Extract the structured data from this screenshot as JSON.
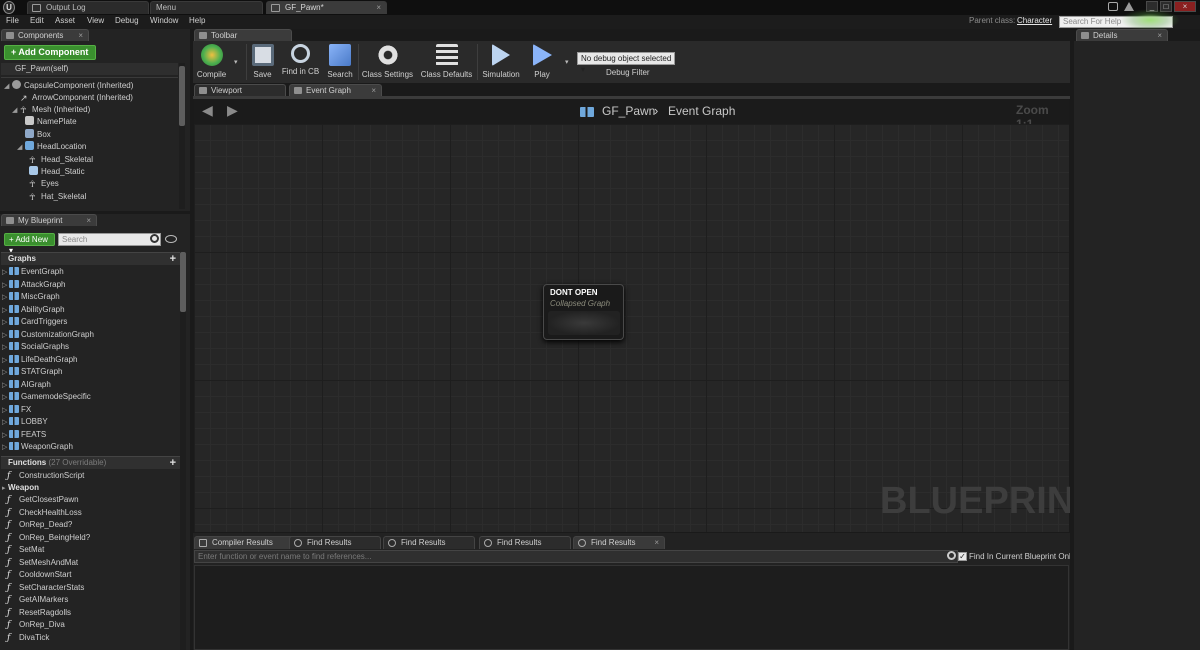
{
  "titlebar": {
    "logo": "U",
    "tabs": [
      {
        "label": "Output Log",
        "active": false
      },
      {
        "label": "Menu",
        "active": false
      },
      {
        "label": "GF_Pawn*",
        "active": true
      }
    ],
    "window_buttons": [
      "_",
      "□",
      "×"
    ]
  },
  "menubar": {
    "items": [
      "File",
      "Edit",
      "Asset",
      "View",
      "Debug",
      "Window",
      "Help"
    ],
    "parent_class_label": "Parent class:",
    "parent_class_value": "Character",
    "search_help_placeholder": "Search For Help"
  },
  "components": {
    "tab_label": "Components",
    "add_button": "+ Add Component ▾",
    "self_row": "GF_Pawn(self)",
    "items": [
      {
        "label": "CapsuleComponent (Inherited)",
        "indent": 0,
        "arrow": "◢"
      },
      {
        "label": "ArrowComponent (Inherited)",
        "indent": 1,
        "arrow": ""
      },
      {
        "label": "Mesh (Inherited)",
        "indent": 1,
        "arrow": "◢"
      },
      {
        "label": "NamePlate",
        "indent": 2,
        "arrow": ""
      },
      {
        "label": "Box",
        "indent": 2,
        "arrow": ""
      },
      {
        "label": "HeadLocation",
        "indent": 2,
        "arrow": "◢"
      },
      {
        "label": "Head_Skeletal",
        "indent": 3,
        "arrow": ""
      },
      {
        "label": "Head_Static",
        "indent": 3,
        "arrow": ""
      },
      {
        "label": "Eyes",
        "indent": 3,
        "arrow": ""
      },
      {
        "label": "Hat_Skeletal",
        "indent": 3,
        "arrow": ""
      }
    ]
  },
  "my_blueprint": {
    "tab_label": "My Blueprint",
    "add_new": "+ Add New ▾",
    "search_placeholder": "Search",
    "graphs_header": "Graphs",
    "graphs": [
      "EventGraph",
      "AttackGraph",
      "MiscGraph",
      "AbilityGraph",
      "CardTriggers",
      "CustomizationGraph",
      "SocialGraphs",
      "LifeDeathGraph",
      "STATGraph",
      "AIGraph",
      "GamemodeSpecific",
      "FX",
      "LOBBY",
      "FEATS",
      "WeaponGraph"
    ],
    "functions_header": "Functions",
    "functions_sub": "(27 Overridable)",
    "construction_script": "ConstructionScript",
    "weapon_category": "Weapon",
    "functions": [
      "GetClosestPawn",
      "CheckHealthLoss",
      "OnRep_Dead?",
      "OnRep_BeingHeld?",
      "SetMat",
      "SetMeshAndMat",
      "CooldownStart",
      "SetCharacterStats",
      "GetAIMarkers",
      "ResetRagdolls",
      "OnRep_Diva",
      "DivaTick"
    ]
  },
  "toolbar": {
    "tab_label": "Toolbar",
    "buttons": [
      {
        "label": "Compile",
        "color": "#4caf50"
      },
      {
        "label": "Save",
        "color": "#cfd8e3"
      },
      {
        "label": "Find in CB",
        "color": "#9fb3c8"
      },
      {
        "label": "Search",
        "color": "#8ab4f8"
      },
      {
        "label": "Class Settings",
        "color": "#e0e0e0"
      },
      {
        "label": "Class Defaults",
        "color": "#e0e0e0"
      },
      {
        "label": "Simulation",
        "color": "#bcd4f0"
      },
      {
        "label": "Play",
        "color": "#8ab4f8"
      }
    ],
    "debug_select": "No debug object selected ▾",
    "debug_filter_label": "Debug Filter"
  },
  "editor_tabs": [
    {
      "label": "Viewport",
      "active": false
    },
    {
      "label": "Event Graph",
      "active": true
    }
  ],
  "graph": {
    "breadcrumb_root": "GF_Pawn",
    "breadcrumb_sep": "›",
    "breadcrumb_current": "Event Graph",
    "zoom": "Zoom 1:1",
    "node_title": "DONT OPEN",
    "node_subtitle": "Collapsed Graph",
    "watermark": "BLUEPRINT"
  },
  "bottom": {
    "tabs": [
      "Compiler Results",
      "Find Results",
      "Find Results",
      "Find Results",
      "Find Results"
    ],
    "find_placeholder": "Enter function or event name to find references...",
    "find_checkbox_label": "Find In Current Blueprint Only"
  },
  "details": {
    "tab_label": "Details"
  }
}
